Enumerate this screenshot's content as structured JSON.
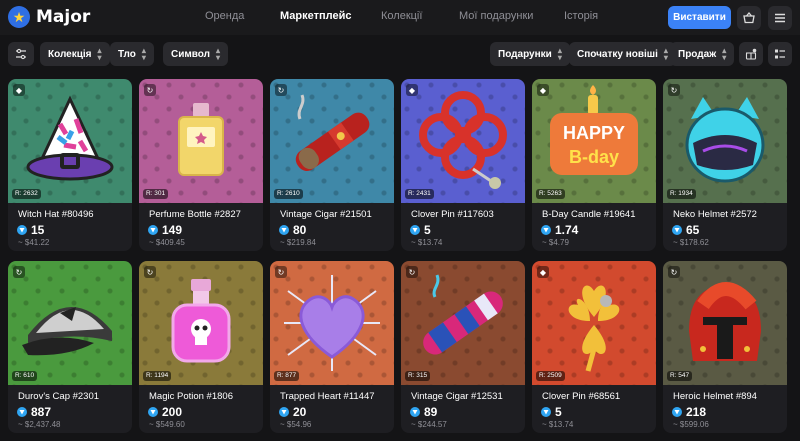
{
  "app": {
    "name": "Major",
    "logo_icon": "star-logo-icon"
  },
  "nav": {
    "items": [
      {
        "label": "Оренда",
        "active": false
      },
      {
        "label": "Маркетплейс",
        "active": true
      },
      {
        "label": "Колекції",
        "active": false
      },
      {
        "label": "Мої подарунки",
        "active": false
      },
      {
        "label": "Історія",
        "active": false
      }
    ],
    "cta_label": "Виставити"
  },
  "filters": {
    "left": [
      "Колекція",
      "Тло",
      "Символ"
    ],
    "right": [
      "Подарунки",
      "Спочатку новіші",
      "Продаж"
    ]
  },
  "colors": {
    "accent": "#3b82f6",
    "ton": "#2fa5f2",
    "card_bg": "#1e1e22"
  },
  "gifts": [
    {
      "name": "Witch Hat #80496",
      "rarity": "R: 2632",
      "price": "15",
      "usd": "~ $41.22",
      "badge": "diamond-icon",
      "bg": "#3f8a6e",
      "art": "witch-hat"
    },
    {
      "name": "Perfume Bottle #2827",
      "rarity": "R: 301",
      "price": "149",
      "usd": "~ $409.45",
      "badge": "refresh-icon",
      "bg": "#b45e98",
      "art": "perfume"
    },
    {
      "name": "Vintage Cigar #21501",
      "rarity": "R: 2610",
      "price": "80",
      "usd": "~ $219.84",
      "badge": "refresh-icon",
      "bg": "#3f88a8",
      "art": "cigar-red"
    },
    {
      "name": "Clover Pin #117603",
      "rarity": "R: 2431",
      "price": "5",
      "usd": "~ $13.74",
      "badge": "diamond-icon",
      "bg": "#5a5fd0",
      "art": "clover-red"
    },
    {
      "name": "B-Day Candle #19641",
      "rarity": "R: 5263",
      "price": "1.74",
      "usd": "~ $4.79",
      "badge": "diamond-icon",
      "bg": "#6b8a4a",
      "art": "candle"
    },
    {
      "name": "Neko Helmet #2572",
      "rarity": "R: 1934",
      "price": "65",
      "usd": "~ $178.62",
      "badge": "refresh-icon",
      "bg": "#56704e",
      "art": "neko"
    },
    {
      "name": "Durov's Cap #2301",
      "rarity": "R: 610",
      "price": "887",
      "usd": "~ $2,437.48",
      "badge": "refresh-icon",
      "bg": "#4a9a3e",
      "art": "cap"
    },
    {
      "name": "Magic Potion #1806",
      "rarity": "R: 1194",
      "price": "200",
      "usd": "~ $549.60",
      "badge": "refresh-icon",
      "bg": "#8a7a3a",
      "art": "potion"
    },
    {
      "name": "Trapped Heart #11447",
      "rarity": "R: 877",
      "price": "20",
      "usd": "~ $54.96",
      "badge": "refresh-icon",
      "bg": "#d06a42",
      "art": "heart"
    },
    {
      "name": "Vintage Cigar #12531",
      "rarity": "R: 315",
      "price": "89",
      "usd": "~ $244.57",
      "badge": "refresh-icon",
      "bg": "#8a4a30",
      "art": "cigar-blue"
    },
    {
      "name": "Clover Pin #68561",
      "rarity": "R: 2509",
      "price": "5",
      "usd": "~ $13.74",
      "badge": "diamond-icon",
      "bg": "#d24a2e",
      "art": "clover-gold"
    },
    {
      "name": "Heroic Helmet #894",
      "rarity": "R: 547",
      "price": "218",
      "usd": "~ $599.06",
      "badge": "refresh-icon",
      "bg": "#5a5a44",
      "art": "helmet"
    }
  ]
}
